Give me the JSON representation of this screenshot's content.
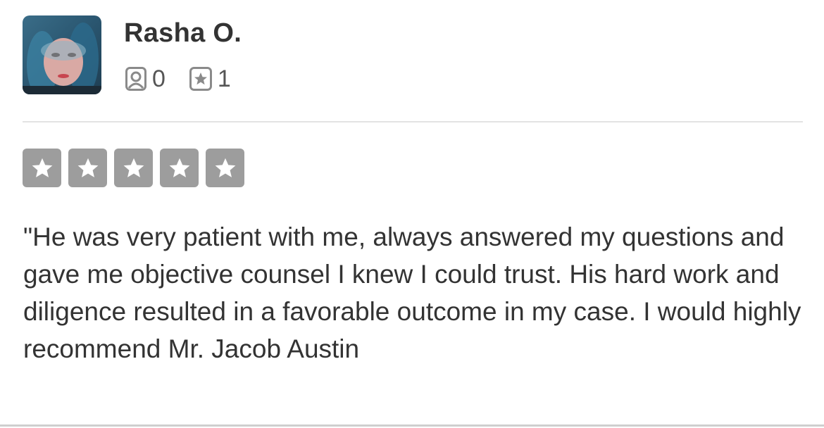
{
  "user": {
    "name": "Rasha O.",
    "friends_count": "0",
    "reviews_count": "1"
  },
  "rating": {
    "stars": 5,
    "max": 5,
    "color": "#9d9d9d"
  },
  "review": {
    "text": "\"He was very patient with me, always answered my questions and gave me objective counsel I knew I could trust. His hard work and diligence resulted in a favorable outcome in my case. I would highly recommend Mr. Jacob Austin"
  },
  "icons": {
    "friends": "person-box-icon",
    "reviews": "star-box-icon"
  }
}
